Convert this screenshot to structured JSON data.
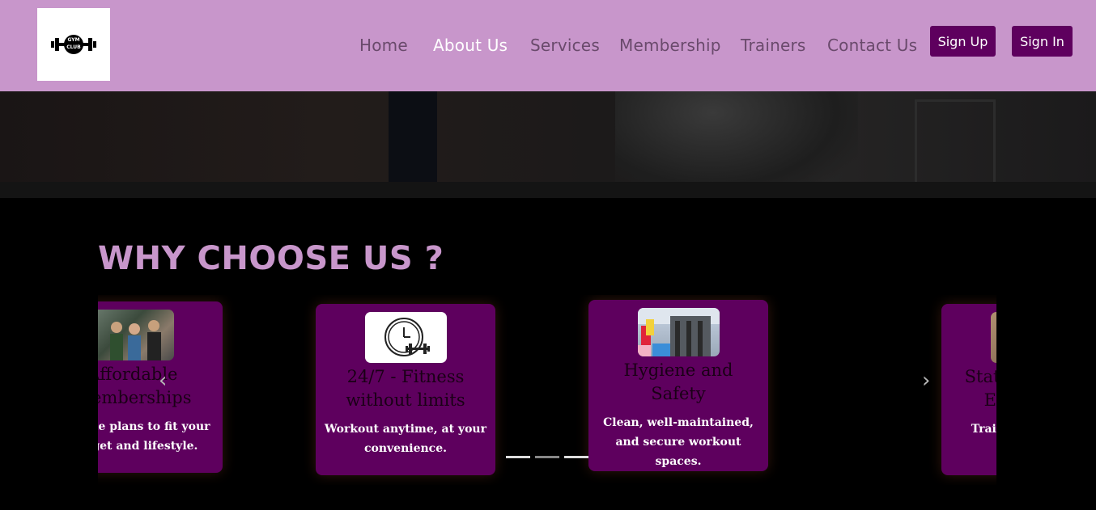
{
  "logo": {
    "line1": "GYM",
    "line2": "CLUB"
  },
  "nav": {
    "items": [
      {
        "label": "Home",
        "active": false
      },
      {
        "label": "About Us",
        "active": true
      },
      {
        "label": "Services",
        "active": false
      },
      {
        "label": "Membership",
        "active": false
      },
      {
        "label": "Trainers",
        "active": false
      },
      {
        "label": "Contact Us",
        "active": false
      }
    ],
    "signup_label": "Sign Up",
    "signin_label": "Sign In"
  },
  "section": {
    "title": "WHY CHOOSE US ?",
    "cards": [
      {
        "title": "Affordable Memberships",
        "text": "Flexible plans to fit your budget and lifestyle.",
        "icon": "people-meeting-photo"
      },
      {
        "title": "24/7 - Fitness without limits",
        "text": "Workout anytime, at your convenience.",
        "icon": "clock-dumbbell-icon"
      },
      {
        "title": "Hygiene and Safety",
        "text": "Clean, well-maintained, and secure workout spaces.",
        "icon": "gym-cleaning-photo"
      },
      {
        "title": "State of the Art Equipment",
        "text": "Train with the best machines.",
        "icon": "equipment-photo"
      }
    ]
  },
  "carousel": {
    "prev_icon": "‹",
    "next_icon": "›",
    "indicator_count": 3,
    "active_indicator": 2
  },
  "colors": {
    "header_bg": "#c896cb",
    "accent": "#5e005e",
    "title": "#c896cb"
  }
}
